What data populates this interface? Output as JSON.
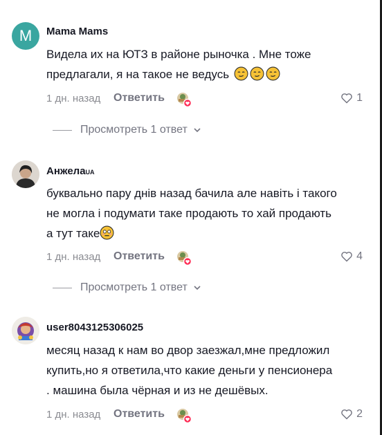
{
  "comments": [
    {
      "avatar_letter": "M",
      "username": "Mama Mams",
      "badge": "",
      "text_lines": [
        "Видела их на ЮТЗ в районе рыночка . Мне тоже",
        "предлагали, я на такое не ведусь"
      ],
      "emoji_count": 3,
      "time": "1 дн. назад",
      "reply_label": "Ответить",
      "likes": "1",
      "view_replies": "Просмотреть 1 ответ"
    },
    {
      "username": "Анжела",
      "badge": "UA",
      "text_lines": [
        "буквально пару днів назад бачила але навіть і такого",
        "не могла і подумати таке продають то хай продають",
        "а тут таке"
      ],
      "emoji_count": 1,
      "time": "1 дн. назад",
      "reply_label": "Ответить",
      "likes": "4",
      "view_replies": "Просмотреть 1 ответ"
    },
    {
      "username": "user8043125306025",
      "badge": "",
      "text_lines": [
        "месяц назад к нам во двор заезжал,мне предложил",
        "купить,но я ответила,что какие деньги у пенсионера",
        ". машина была чёрная и из не дешёвых."
      ],
      "time": "1 дн. назад",
      "reply_label": "Ответить",
      "likes": "2"
    }
  ],
  "colors": {
    "avatar_m": "#3aa6a0",
    "muted": "#8a8b91",
    "like_heart": "#fe2c55"
  },
  "icons": [
    "heart-outline-icon",
    "chevron-down-icon",
    "creator-liked-icon",
    "emoji-icon"
  ]
}
